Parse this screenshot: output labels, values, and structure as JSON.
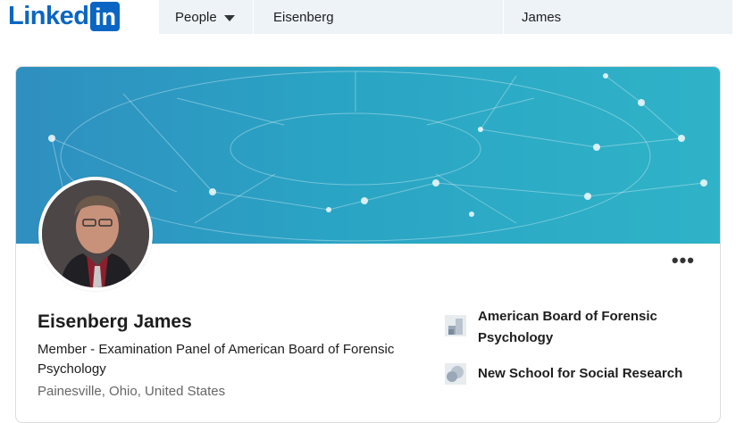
{
  "header": {
    "logo_text": "Linked",
    "logo_box_text": "in",
    "search": {
      "category": "People",
      "first_name": "Eisenberg",
      "last_name": "James"
    }
  },
  "profile": {
    "name": "Eisenberg James",
    "headline": "Member - Examination Panel of American Board of Forensic Psychology",
    "location": "Painesville, Ohio, United States",
    "more_label": "•••"
  },
  "organizations": [
    {
      "name": "American Board of Forensic Psychology",
      "icon": "building-icon"
    },
    {
      "name": "New School for Social Research",
      "icon": "school-icon"
    }
  ],
  "colors": {
    "brand": "#0a66c2",
    "banner": "#2aa4c4",
    "search_bg": "#eef3f8"
  }
}
